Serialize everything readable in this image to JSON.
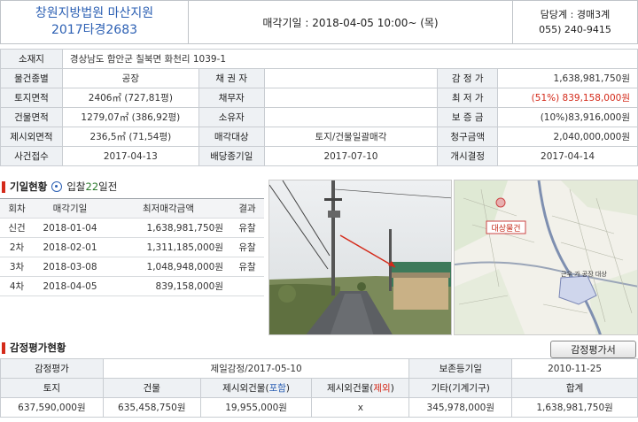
{
  "header": {
    "court": "창원지방법원 마산지원",
    "case_no": "2017타경2683",
    "sale_date": "매각기일 : 2018-04-05   10:00~ (목)",
    "dept": "담당계 : 경매3계",
    "phone": "055) 240-9415"
  },
  "info": {
    "address_label": "소재지",
    "address": "경상남도 함안군 칠북면 화천리 1039-1",
    "type_label": "물건종별",
    "type": "공장",
    "creditor_label": "채 권 자",
    "creditor": "",
    "appraisal_label": "감 정 가",
    "appraisal": "1,638,981,750원",
    "land_label": "토지면적",
    "land": "2406㎡ (727,81평)",
    "debtor_label": "채무자",
    "debtor": "",
    "min_label": "최 저 가",
    "min": "(51%) 839,158,000원",
    "bldg_label": "건물면적",
    "bldg": "1279,07㎡ (386,92평)",
    "owner_label": "소유자",
    "owner": "",
    "deposit_label": "보 증 금",
    "deposit": "(10%)83,916,000원",
    "excl_label": "제시외면적",
    "excl": "236,5㎡ (71,54평)",
    "target_label": "매각대상",
    "target": "토지/건물일괄매각",
    "claim_label": "청구금액",
    "claim": "2,040,000,000원",
    "filed_label": "사건접수",
    "filed": "2017-04-13",
    "deadline_label": "배당종기일",
    "deadline": "2017-07-10",
    "start_label": "개시결정",
    "start": "2017-04-14"
  },
  "history": {
    "title": "기일현황",
    "bid_prefix": "입찰",
    "bid_days": "22",
    "bid_suffix": "일전",
    "headers": [
      "회차",
      "매각기일",
      "최저매각금액",
      "결과"
    ],
    "rows": [
      [
        "신건",
        "2018-01-04",
        "1,638,981,750원",
        "유찰"
      ],
      [
        "2차",
        "2018-02-01",
        "1,311,185,000원",
        "유찰"
      ],
      [
        "3차",
        "2018-03-08",
        "1,048,948,000원",
        "유찰"
      ],
      [
        "4차",
        "2018-04-05",
        "839,158,000원",
        ""
      ]
    ]
  },
  "map_labels": {
    "target": "대상물건",
    "area": "근우 가 공장 대상"
  },
  "appraisal": {
    "title": "감정평가현황",
    "button": "감정평가서",
    "r1": {
      "a": "감정평가",
      "b": "제일감정/2017-05-10",
      "c": "보존등기일",
      "d": "2010-11-25"
    },
    "headers": {
      "land": "토지",
      "bldg": "건물",
      "inc_pre": "제시외건물(",
      "inc_mid": "포함",
      "exc_pre": "제시외건물(",
      "exc_mid": "제외",
      "close": ")",
      "etc": "기타(기계기구)",
      "total": "합계"
    },
    "values": [
      "637,590,000원",
      "635,458,750원",
      "19,955,000원",
      "x",
      "345,978,000원",
      "1,638,981,750원"
    ]
  },
  "colors": {
    "accent_blue": "#2b5fb3",
    "accent_red": "#d42a1a",
    "label_bg": "#eef1f4"
  }
}
